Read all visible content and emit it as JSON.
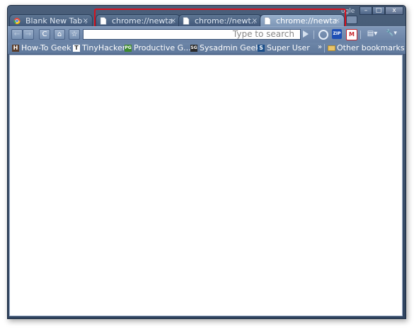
{
  "tabs": [
    {
      "label": "Blank New Tab ...",
      "close": "×",
      "active": false,
      "favicon": "chrome-logo-icon"
    },
    {
      "label": "chrome://newta...",
      "close": "×",
      "active": false,
      "favicon": "page-icon"
    },
    {
      "label": "chrome://newt...",
      "close": "×",
      "active": false,
      "favicon": "page-icon"
    },
    {
      "label": "chrome://newta...",
      "close": "×",
      "active": true,
      "favicon": "page-icon"
    }
  ],
  "window_controls": {
    "minimize": "–",
    "maximize": "□",
    "close": "x",
    "google_mark": "ogle"
  },
  "toolbar": {
    "back": "←",
    "forward": "→",
    "reload": "C",
    "home": "⌂",
    "star": "☆",
    "omnibox_placeholder": "Type to search",
    "page_menu": "▤▾",
    "wrench_menu": "🔧▾"
  },
  "extensions": [
    {
      "name": "extension-o-icon",
      "text": "O",
      "color": "#e6eef8"
    },
    {
      "name": "extension-zip-icon",
      "text": "ZIP",
      "color": "#1e4fb5"
    },
    {
      "name": "extension-gmail-icon",
      "text": "M",
      "color": "#c7272e"
    }
  ],
  "bookmarks": [
    {
      "label": "How-To Geek",
      "icon": "howtogeek-icon",
      "icon_text": "H"
    },
    {
      "label": "TinyHacker",
      "icon": "tinyhacker-icon",
      "icon_text": "T"
    },
    {
      "label": "Productive G...",
      "icon": "productive-geek-icon",
      "icon_text": "PG"
    },
    {
      "label": "Sysadmin Geek",
      "icon": "sysadmin-geek-icon",
      "icon_text": "SG"
    },
    {
      "label": "Super User",
      "icon": "superuser-icon",
      "icon_text": "S"
    }
  ],
  "bookmarks_more": "»",
  "other_bookmarks": "Other bookmarks",
  "colors": {
    "frame": "#3d5374",
    "highlight": "#d8121e",
    "active_tab": "#8aa3c2"
  }
}
